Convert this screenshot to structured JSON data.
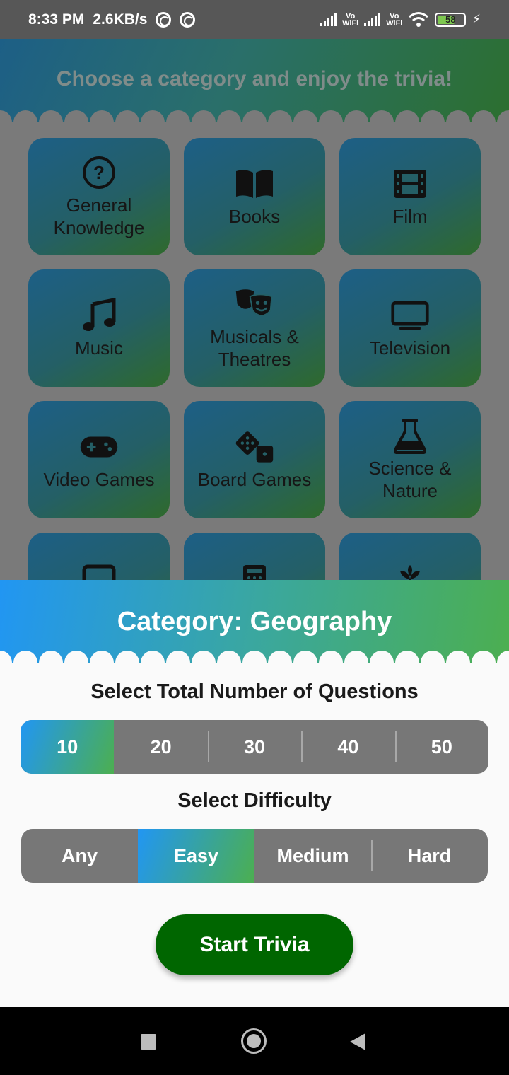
{
  "status_bar": {
    "time": "8:33 PM",
    "speed": "2.6KB/s",
    "vo_label": "Vo",
    "wifi_label": "WiFi",
    "battery": "58"
  },
  "background": {
    "header_title": "Choose a category and enjoy the trivia!",
    "categories": [
      {
        "label": "General Knowledge",
        "icon": "question-circle-icon"
      },
      {
        "label": "Books",
        "icon": "book-open-icon"
      },
      {
        "label": "Film",
        "icon": "film-icon"
      },
      {
        "label": "Music",
        "icon": "music-note-icon"
      },
      {
        "label": "Musicals & Theatres",
        "icon": "theater-masks-icon"
      },
      {
        "label": "Television",
        "icon": "tv-icon"
      },
      {
        "label": "Video Games",
        "icon": "gamepad-icon"
      },
      {
        "label": "Board Games",
        "icon": "dice-icon"
      },
      {
        "label": "Science & Nature",
        "icon": "flask-icon"
      }
    ],
    "partial_icons": [
      "tablet-icon",
      "calculator-icon",
      "plant-icon"
    ]
  },
  "sheet": {
    "title": "Category: Geography",
    "questions_label": "Select Total Number of Questions",
    "question_options": [
      "10",
      "20",
      "30",
      "40",
      "50"
    ],
    "selected_question": "10",
    "difficulty_label": "Select Difficulty",
    "difficulty_options": [
      "Any",
      "Easy",
      "Medium",
      "Hard"
    ],
    "selected_difficulty": "Easy",
    "start_button": "Start Trivia"
  },
  "colors": {
    "accent_start": "#2196f3",
    "accent_end": "#4caf50",
    "start_button": "#006600",
    "segment_bg": "#777777"
  }
}
